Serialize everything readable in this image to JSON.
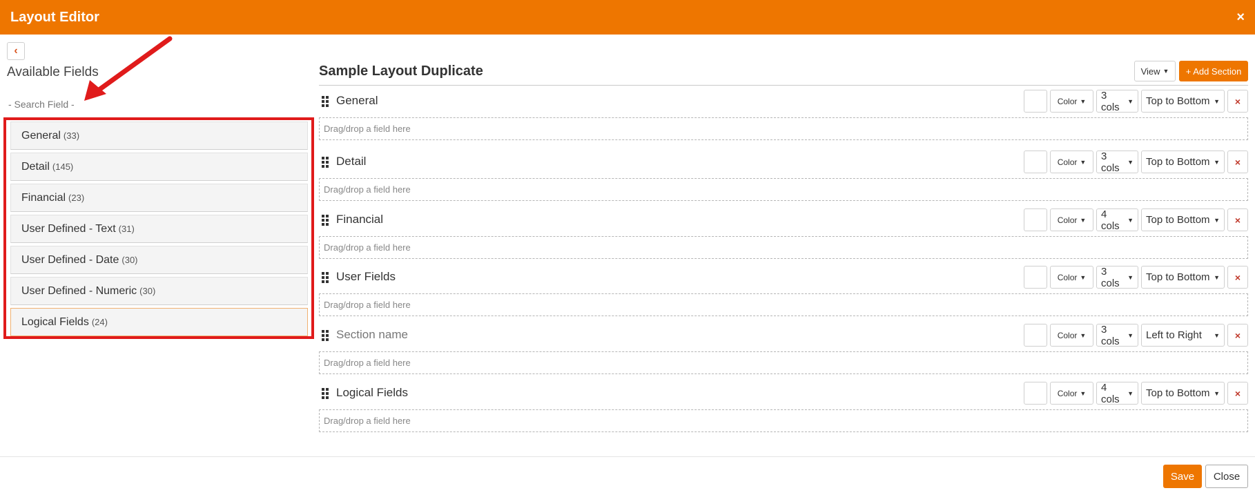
{
  "window": {
    "title": "Layout Editor",
    "close_label": "×"
  },
  "left_panel": {
    "back_icon": "chevron-left-icon",
    "title": "Available Fields",
    "search_placeholder": "- Search Field -",
    "categories": [
      {
        "name": "General",
        "count": "(33)"
      },
      {
        "name": "Detail",
        "count": "(145)"
      },
      {
        "name": "Financial",
        "count": "(23)"
      },
      {
        "name": "User Defined - Text",
        "count": "(31)"
      },
      {
        "name": "User Defined - Date",
        "count": "(30)"
      },
      {
        "name": "User Defined - Numeric",
        "count": "(30)"
      },
      {
        "name": "Logical Fields",
        "count": "(24)"
      }
    ]
  },
  "layout": {
    "title": "Sample Layout Duplicate",
    "view_label": "View",
    "add_section_label": "+ Add Section",
    "drop_placeholder": "Drag/drop a field here",
    "color_label": "Color",
    "delete_label": "×",
    "sections": [
      {
        "name": "General",
        "cols": "3 cols",
        "direction": "Top to Bottom",
        "is_placeholder": false
      },
      {
        "name": "Detail",
        "cols": "3 cols",
        "direction": "Top to Bottom",
        "is_placeholder": false
      },
      {
        "name": "Financial",
        "cols": "4 cols",
        "direction": "Top to Bottom",
        "is_placeholder": false
      },
      {
        "name": "User Fields",
        "cols": "3 cols",
        "direction": "Top to Bottom",
        "is_placeholder": false
      },
      {
        "name": "Section name",
        "cols": "3 cols",
        "direction": "Left to Right",
        "is_placeholder": true
      },
      {
        "name": "Logical Fields",
        "cols": "4 cols",
        "direction": "Top to Bottom",
        "is_placeholder": false
      }
    ]
  },
  "footer": {
    "save_label": "Save",
    "close_label": "Close"
  },
  "colors": {
    "accent": "#ee7600",
    "highlight": "#e01b1b",
    "delete": "#c0392b"
  }
}
